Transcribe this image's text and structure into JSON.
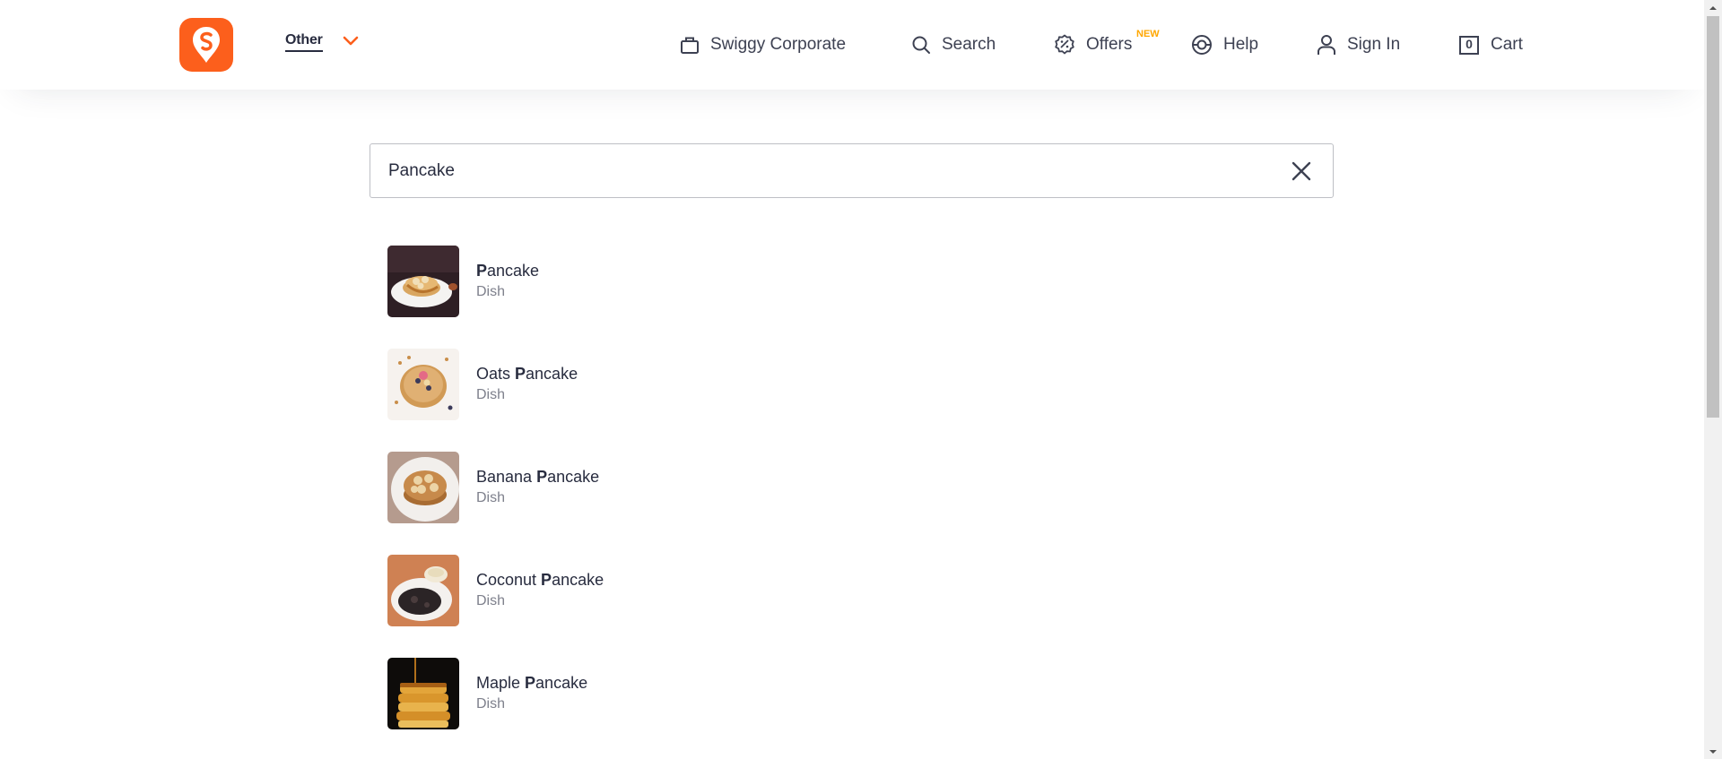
{
  "header": {
    "location_label": "Other",
    "nav": [
      {
        "label": "Swiggy Corporate",
        "icon": "briefcase-icon"
      },
      {
        "label": "Search",
        "icon": "search-icon"
      },
      {
        "label": "Offers",
        "icon": "offers-icon",
        "badge": "NEW"
      },
      {
        "label": "Help",
        "icon": "help-icon"
      },
      {
        "label": "Sign In",
        "icon": "user-icon"
      },
      {
        "label": "Cart",
        "icon": "cart-icon",
        "count": "0"
      }
    ]
  },
  "search": {
    "value": "Pancake"
  },
  "results": [
    {
      "name_prefix": "",
      "name_match": "P",
      "name_rest": "ancake",
      "type": "Dish"
    },
    {
      "name_prefix": "Oats ",
      "name_match": "P",
      "name_rest": "ancake",
      "type": "Dish"
    },
    {
      "name_prefix": "Banana ",
      "name_match": "P",
      "name_rest": "ancake",
      "type": "Dish"
    },
    {
      "name_prefix": "Coconut ",
      "name_match": "P",
      "name_rest": "ancake",
      "type": "Dish"
    },
    {
      "name_prefix": "Maple ",
      "name_match": "P",
      "name_rest": "ancake",
      "type": "Dish"
    }
  ],
  "colors": {
    "brand": "#fc5f1c",
    "badge": "#ffa700",
    "text_dark": "#282c3f",
    "text_muted": "#7e808c"
  }
}
